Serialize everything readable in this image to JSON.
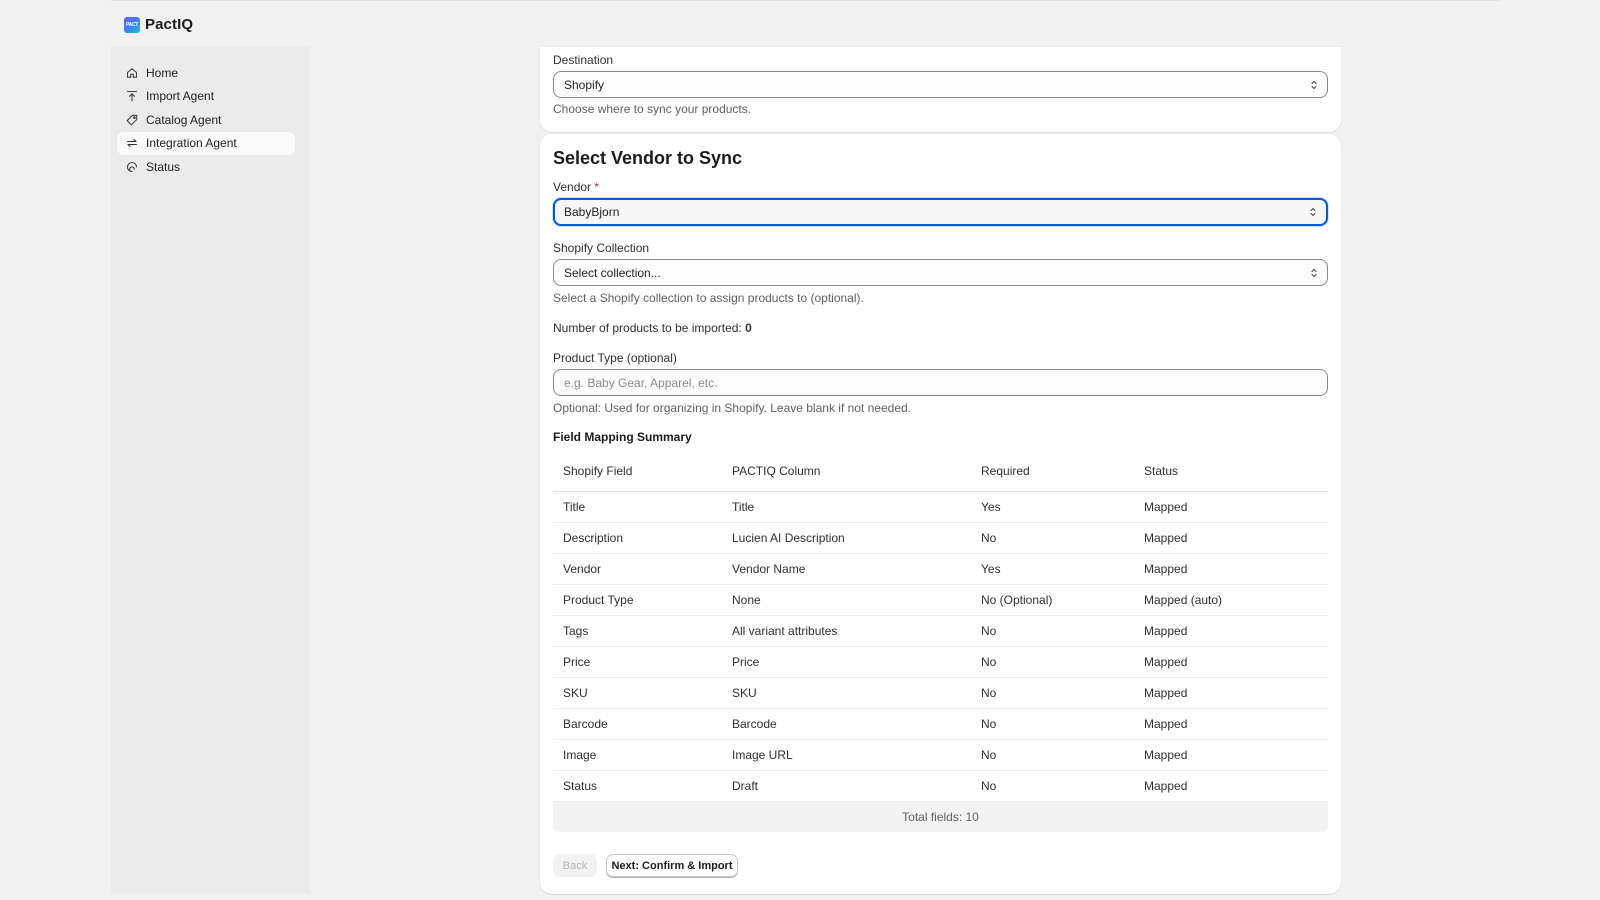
{
  "app": {
    "logo_mark": "PACT",
    "name": "PactIQ"
  },
  "sidebar": {
    "items": [
      {
        "label": "Home",
        "icon": "home-icon",
        "active": false
      },
      {
        "label": "Import Agent",
        "icon": "upload-icon",
        "active": false
      },
      {
        "label": "Catalog Agent",
        "icon": "tag-icon",
        "active": false
      },
      {
        "label": "Integration Agent",
        "icon": "sync-icon",
        "active": true
      },
      {
        "label": "Status",
        "icon": "gauge-icon",
        "active": false
      }
    ]
  },
  "destination": {
    "label": "Destination",
    "value": "Shopify",
    "help": "Choose where to sync your products."
  },
  "vendor_section": {
    "title": "Select Vendor to Sync",
    "vendor_label": "Vendor",
    "vendor_required_mark": "*",
    "vendor_value": "BabyBjorn",
    "collection_label": "Shopify Collection",
    "collection_value": "Select collection...",
    "collection_help": "Select a Shopify collection to assign products to (optional).",
    "count_label": "Number of products to be imported:",
    "count_value": "0",
    "product_type_label": "Product Type (optional)",
    "product_type_placeholder": "e.g. Baby Gear, Apparel, etc.",
    "product_type_help": "Optional: Used for organizing in Shopify. Leave blank if not needed."
  },
  "mapping": {
    "title": "Field Mapping Summary",
    "columns": [
      "Shopify Field",
      "PACTIQ Column",
      "Required",
      "Status"
    ],
    "rows": [
      [
        "Title",
        "Title",
        "Yes",
        "Mapped"
      ],
      [
        "Description",
        "Lucien AI Description",
        "No",
        "Mapped"
      ],
      [
        "Vendor",
        "Vendor Name",
        "Yes",
        "Mapped"
      ],
      [
        "Product Type",
        "None",
        "No (Optional)",
        "Mapped (auto)"
      ],
      [
        "Tags",
        "All variant attributes",
        "No",
        "Mapped"
      ],
      [
        "Price",
        "Price",
        "No",
        "Mapped"
      ],
      [
        "SKU",
        "SKU",
        "No",
        "Mapped"
      ],
      [
        "Barcode",
        "Barcode",
        "No",
        "Mapped"
      ],
      [
        "Image",
        "Image URL",
        "No",
        "Mapped"
      ],
      [
        "Status",
        "Draft",
        "No",
        "Mapped"
      ]
    ],
    "total": "Total fields: 10"
  },
  "actions": {
    "back": "Back",
    "next": "Next: Confirm & Import"
  },
  "colors": {
    "focus": "#005bd3",
    "required": "#c4261f"
  }
}
